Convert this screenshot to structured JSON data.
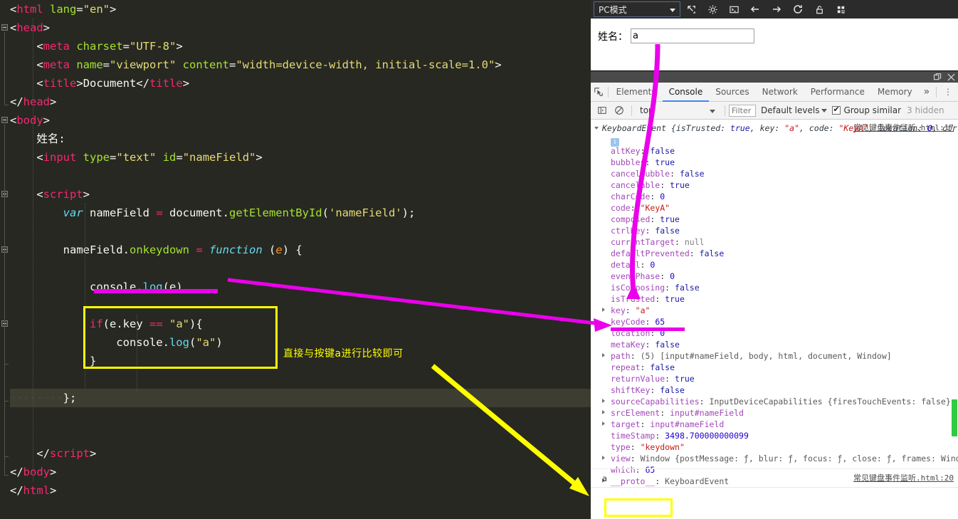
{
  "editor": {
    "lines": [
      {
        "id": "l1",
        "segments": [
          {
            "t": "<",
            "c": "punct"
          },
          {
            "t": "html",
            "c": "tag"
          },
          {
            "t": " lang",
            "c": "attr"
          },
          {
            "t": "=",
            "c": "punct"
          },
          {
            "t": "\"en\"",
            "c": "str"
          },
          {
            "t": ">",
            "c": "punct"
          }
        ]
      },
      {
        "id": "l2",
        "segments": [
          {
            "t": "<",
            "c": "punct"
          },
          {
            "t": "head",
            "c": "tag"
          },
          {
            "t": ">",
            "c": "punct"
          }
        ]
      },
      {
        "id": "l3",
        "segments": [
          {
            "t": "    <",
            "c": "punct"
          },
          {
            "t": "meta",
            "c": "tag"
          },
          {
            "t": " charset",
            "c": "attr"
          },
          {
            "t": "=",
            "c": "punct"
          },
          {
            "t": "\"UTF-8\"",
            "c": "str"
          },
          {
            "t": ">",
            "c": "punct"
          }
        ]
      },
      {
        "id": "l4",
        "segments": [
          {
            "t": "    <",
            "c": "punct"
          },
          {
            "t": "meta",
            "c": "tag"
          },
          {
            "t": " name",
            "c": "attr"
          },
          {
            "t": "=",
            "c": "punct"
          },
          {
            "t": "\"viewport\"",
            "c": "str"
          },
          {
            "t": " content",
            "c": "attr"
          },
          {
            "t": "=",
            "c": "punct"
          },
          {
            "t": "\"width=device-width, initial-scale=1.0\"",
            "c": "str"
          },
          {
            "t": ">",
            "c": "punct"
          }
        ]
      },
      {
        "id": "l5",
        "segments": [
          {
            "t": "    <",
            "c": "punct"
          },
          {
            "t": "title",
            "c": "tag"
          },
          {
            "t": ">",
            "c": "punct"
          },
          {
            "t": "Document",
            "c": "txt"
          },
          {
            "t": "</",
            "c": "punct"
          },
          {
            "t": "title",
            "c": "tag"
          },
          {
            "t": ">",
            "c": "punct"
          }
        ]
      },
      {
        "id": "l6",
        "segments": [
          {
            "t": "</",
            "c": "punct"
          },
          {
            "t": "head",
            "c": "tag"
          },
          {
            "t": ">",
            "c": "punct"
          }
        ]
      },
      {
        "id": "l7",
        "segments": [
          {
            "t": "<",
            "c": "punct"
          },
          {
            "t": "body",
            "c": "tag"
          },
          {
            "t": ">",
            "c": "punct"
          }
        ]
      },
      {
        "id": "l8",
        "segments": [
          {
            "t": "    姓名:",
            "c": "txt"
          }
        ]
      },
      {
        "id": "l9",
        "segments": [
          {
            "t": "    <",
            "c": "punct"
          },
          {
            "t": "input",
            "c": "tag"
          },
          {
            "t": " type",
            "c": "attr"
          },
          {
            "t": "=",
            "c": "punct"
          },
          {
            "t": "\"text\"",
            "c": "str"
          },
          {
            "t": " id",
            "c": "attr"
          },
          {
            "t": "=",
            "c": "punct"
          },
          {
            "t": "\"nameField\"",
            "c": "str"
          },
          {
            "t": ">",
            "c": "punct"
          }
        ]
      },
      {
        "id": "l10",
        "segments": []
      },
      {
        "id": "l11",
        "segments": [
          {
            "t": "    <",
            "c": "punct"
          },
          {
            "t": "script",
            "c": "tag"
          },
          {
            "t": ">",
            "c": "punct"
          }
        ]
      },
      {
        "id": "l12",
        "segments": [
          {
            "t": "        ",
            "c": "punct"
          },
          {
            "t": "var",
            "c": "kw"
          },
          {
            "t": " nameField ",
            "c": "txt"
          },
          {
            "t": "=",
            "c": "op"
          },
          {
            "t": " document.",
            "c": "txt"
          },
          {
            "t": "getElementById",
            "c": "fn"
          },
          {
            "t": "(",
            "c": "punct"
          },
          {
            "t": "'nameField'",
            "c": "str"
          },
          {
            "t": ");",
            "c": "punct"
          }
        ]
      },
      {
        "id": "l13",
        "segments": []
      },
      {
        "id": "l14",
        "segments": [
          {
            "t": "        nameField.",
            "c": "txt"
          },
          {
            "t": "onkeydown",
            "c": "fn"
          },
          {
            "t": " ",
            "c": "txt"
          },
          {
            "t": "=",
            "c": "op"
          },
          {
            "t": " ",
            "c": "txt"
          },
          {
            "t": "function",
            "c": "kw"
          },
          {
            "t": " (",
            "c": "punct"
          },
          {
            "t": "e",
            "c": "param"
          },
          {
            "t": ") {",
            "c": "punct"
          }
        ]
      },
      {
        "id": "l15",
        "segments": []
      },
      {
        "id": "l16",
        "segments": [
          {
            "t": "            console.",
            "c": "txt"
          },
          {
            "t": "log",
            "c": "prop"
          },
          {
            "t": "(e)",
            "c": "punct"
          }
        ]
      },
      {
        "id": "l17",
        "segments": []
      },
      {
        "id": "l18",
        "segments": [
          {
            "t": "            ",
            "c": "punct"
          },
          {
            "t": "if",
            "c": "op"
          },
          {
            "t": "(e.key ",
            "c": "txt"
          },
          {
            "t": "==",
            "c": "op"
          },
          {
            "t": " ",
            "c": "txt"
          },
          {
            "t": "\"a\"",
            "c": "str"
          },
          {
            "t": "){",
            "c": "punct"
          }
        ]
      },
      {
        "id": "l19",
        "segments": [
          {
            "t": "                console.",
            "c": "txt"
          },
          {
            "t": "log",
            "c": "prop"
          },
          {
            "t": "(",
            "c": "punct"
          },
          {
            "t": "\"a\"",
            "c": "str"
          },
          {
            "t": ")",
            "c": "punct"
          }
        ]
      },
      {
        "id": "l20",
        "segments": [
          {
            "t": "            }",
            "c": "punct"
          }
        ]
      },
      {
        "id": "l21",
        "segments": []
      },
      {
        "id": "l22",
        "segments": [
          {
            "t": "········",
            "c": "ws"
          },
          {
            "t": "};",
            "c": "punct"
          }
        ],
        "highlight": true
      },
      {
        "id": "l23",
        "segments": []
      },
      {
        "id": "l24",
        "segments": []
      },
      {
        "id": "l25",
        "segments": [
          {
            "t": "    </",
            "c": "punct"
          },
          {
            "t": "script",
            "c": "tag"
          },
          {
            "t": ">",
            "c": "punct"
          }
        ]
      },
      {
        "id": "l26",
        "segments": [
          {
            "t": "</",
            "c": "punct"
          },
          {
            "t": "body",
            "c": "tag"
          },
          {
            "t": ">",
            "c": "punct"
          }
        ]
      },
      {
        "id": "l27",
        "segments": [
          {
            "t": "</",
            "c": "punct"
          },
          {
            "t": "html",
            "c": "tag"
          },
          {
            "t": ">",
            "c": "punct"
          }
        ]
      }
    ]
  },
  "annotations": {
    "chinese_note": "直接与按键a进行比较即可",
    "magenta_color": "#ea00ea",
    "yellow_color": "#ffff00"
  },
  "browser": {
    "toolbar": {
      "mode_label": "PC模式",
      "icons": [
        "resize-icon",
        "gear-icon",
        "terminal-icon",
        "back-arrow-icon",
        "forward-arrow-icon",
        "reload-icon",
        "unlock-icon",
        "grid-icon"
      ]
    },
    "page": {
      "name_label": "姓名：",
      "name_value": "a",
      "name_placeholder": ""
    }
  },
  "devtools": {
    "titlebar_icons": [
      "dock-icon",
      "close-icon"
    ],
    "tabs": [
      {
        "label": "Elements",
        "active": false
      },
      {
        "label": "Console",
        "active": true
      },
      {
        "label": "Sources",
        "active": false
      },
      {
        "label": "Network",
        "active": false
      },
      {
        "label": "Performance",
        "active": false
      },
      {
        "label": "Memory",
        "active": false
      }
    ],
    "more_tabs": "»",
    "menu": "⋮",
    "filterbar": {
      "context": "top",
      "filter_placeholder": "Filter",
      "levels": "Default levels",
      "group_similar": "Group similar",
      "hidden": "3 hidden"
    },
    "console": {
      "entry1": {
        "source": "常见键盘事件监听.html:17",
        "header": "KeyboardEvent {isTrusted: true, key: \"a\", code: \"KeyA\", location: 0, ctrl",
        "header_parts": [
          {
            "t": "KeyboardEvent {",
            "c": "hdr"
          },
          {
            "t": "isTrusted",
            "c": "hdr"
          },
          {
            "t": ": ",
            "c": "hdr"
          },
          {
            "t": "true",
            "c": "pbool"
          },
          {
            "t": ", ",
            "c": "hdr"
          },
          {
            "t": "key",
            "c": "hdr"
          },
          {
            "t": ": ",
            "c": "hdr"
          },
          {
            "t": "\"a\"",
            "c": "pstr"
          },
          {
            "t": ", ",
            "c": "hdr"
          },
          {
            "t": "code",
            "c": "hdr"
          },
          {
            "t": ": ",
            "c": "hdr"
          },
          {
            "t": "\"KeyA\"",
            "c": "pstr"
          },
          {
            "t": ", ",
            "c": "hdr"
          },
          {
            "t": "location",
            "c": "hdr"
          },
          {
            "t": ": ",
            "c": "hdr"
          },
          {
            "t": "0",
            "c": "pnum"
          },
          {
            "t": ", ctrl",
            "c": "hdr"
          }
        ],
        "properties": [
          {
            "name": "altKey",
            "value": "false",
            "vc": "pbool",
            "expandable": false
          },
          {
            "name": "bubbles",
            "value": "true",
            "vc": "pbool",
            "expandable": false
          },
          {
            "name": "cancelBubble",
            "value": "false",
            "vc": "pbool",
            "expandable": false
          },
          {
            "name": "cancelable",
            "value": "true",
            "vc": "pbool",
            "expandable": false
          },
          {
            "name": "charCode",
            "value": "0",
            "vc": "pnum",
            "expandable": false
          },
          {
            "name": "code",
            "value": "\"KeyA\"",
            "vc": "pstr",
            "expandable": false
          },
          {
            "name": "composed",
            "value": "true",
            "vc": "pbool",
            "expandable": false
          },
          {
            "name": "ctrlKey",
            "value": "false",
            "vc": "pbool",
            "expandable": false
          },
          {
            "name": "currentTarget",
            "value": "null",
            "vc": "pnull",
            "expandable": false
          },
          {
            "name": "defaultPrevented",
            "value": "false",
            "vc": "pbool",
            "expandable": false
          },
          {
            "name": "detail",
            "value": "0",
            "vc": "pnum",
            "expandable": false
          },
          {
            "name": "eventPhase",
            "value": "0",
            "vc": "pnum",
            "expandable": false
          },
          {
            "name": "isComposing",
            "value": "false",
            "vc": "pbool",
            "expandable": false
          },
          {
            "name": "isTrusted",
            "value": "true",
            "vc": "pbool",
            "expandable": false
          },
          {
            "name": "key",
            "value": "\"a\"",
            "vc": "pstr",
            "expandable": true
          },
          {
            "name": "keyCode",
            "value": "65",
            "vc": "pnum",
            "expandable": false
          },
          {
            "name": "location",
            "value": "0",
            "vc": "pnum",
            "expandable": false
          },
          {
            "name": "metaKey",
            "value": "false",
            "vc": "pbool",
            "expandable": false
          },
          {
            "name": "path",
            "value": "(5) [input#nameField, body, html, document, Window]",
            "vc": "pobj",
            "expandable": true
          },
          {
            "name": "repeat",
            "value": "false",
            "vc": "pbool",
            "expandable": false
          },
          {
            "name": "returnValue",
            "value": "true",
            "vc": "pbool",
            "expandable": false
          },
          {
            "name": "shiftKey",
            "value": "false",
            "vc": "pbool",
            "expandable": false
          },
          {
            "name": "sourceCapabilities",
            "value": "InputDeviceCapabilities {firesTouchEvents: false}",
            "vc": "pobj",
            "expandable": true
          },
          {
            "name": "srcElement",
            "value": "input#nameField",
            "vc": "pelem",
            "expandable": true
          },
          {
            "name": "target",
            "value": "input#nameField",
            "vc": "pelem",
            "expandable": true
          },
          {
            "name": "timeStamp",
            "value": "3498.700000000099",
            "vc": "pnum",
            "expandable": false
          },
          {
            "name": "type",
            "value": "\"keydown\"",
            "vc": "pstr",
            "expandable": false
          },
          {
            "name": "view",
            "value": "Window {postMessage: ƒ, blur: ƒ, focus: ƒ, close: ƒ, frames: Wind",
            "vc": "pobj",
            "expandable": true
          },
          {
            "name": "which",
            "value": "65",
            "vc": "pnum",
            "expandable": false
          },
          {
            "name": "__proto__",
            "value": "KeyboardEvent",
            "vc": "pobj",
            "expandable": true
          }
        ]
      },
      "entry2": {
        "value": "a",
        "source": "常见键盘事件监听.html:20"
      }
    }
  }
}
